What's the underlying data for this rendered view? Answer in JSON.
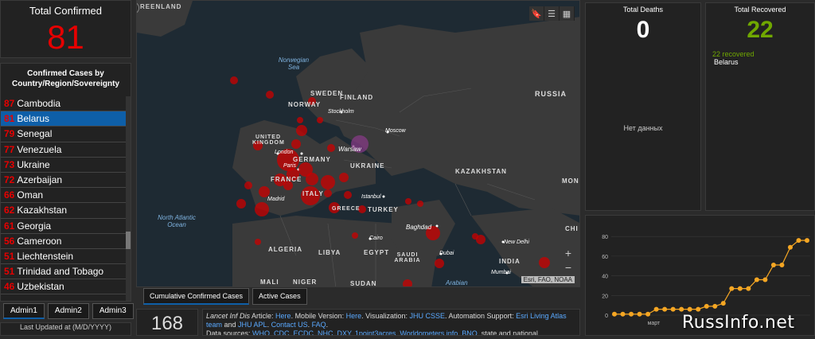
{
  "total_confirmed": {
    "label": "Total Confirmed",
    "value": "81"
  },
  "country_list": {
    "header": "Confirmed Cases by Country/Region/Sovereignty",
    "rows": [
      {
        "count": "87",
        "name": "Cambodia"
      },
      {
        "count": "81",
        "name": "Belarus"
      },
      {
        "count": "79",
        "name": "Senegal"
      },
      {
        "count": "77",
        "name": "Venezuela"
      },
      {
        "count": "73",
        "name": "Ukraine"
      },
      {
        "count": "72",
        "name": "Azerbaijan"
      },
      {
        "count": "66",
        "name": "Oman"
      },
      {
        "count": "62",
        "name": "Kazakhstan"
      },
      {
        "count": "61",
        "name": "Georgia"
      },
      {
        "count": "56",
        "name": "Cameroon"
      },
      {
        "count": "51",
        "name": "Liechtenstein"
      },
      {
        "count": "51",
        "name": "Trinidad and Tobago"
      },
      {
        "count": "46",
        "name": "Uzbekistan"
      }
    ]
  },
  "admin_tabs": [
    "Admin1",
    "Admin2",
    "Admin3"
  ],
  "last_updated": "Last Updated at (M/D/YYYY)",
  "map": {
    "labels": {
      "greenland": "REENLAND",
      "norwegian_sea": "Norwegian Sea",
      "sweden": "SWEDEN",
      "finland": "FINLAND",
      "norway": "NORWAY",
      "russia": "RUSSIA",
      "stockholm": "Stockholm",
      "moscow": "Moscow",
      "uk": "UNITED KINGDOM",
      "london": "London",
      "warsaw": "Warsaw",
      "germany": "GERMANY",
      "ukraine": "UKRAINE",
      "kazakhstan": "KAZAKHSTAN",
      "paris": "Paris",
      "france": "FRANCE",
      "italy": "ITALY",
      "madrid": "Madrid",
      "istanbul": "Istanbul",
      "greece": "GREECE",
      "turkey": "TURKEY",
      "mongolia": "MONG",
      "north_atlantic": "North Atlantic Ocean",
      "baghdad": "Baghdad",
      "china": "CHI",
      "algeria": "ALGERIA",
      "libya": "LIBYA",
      "egypt": "EGYPT",
      "cairo": "Cairo",
      "saudi": "SAUDI ARABIA",
      "dubai": "Dubai",
      "new_delhi": "New Delhi",
      "india": "INDIA",
      "mali": "MALI",
      "niger": "NIGER",
      "sudan": "SUDAN",
      "arabian": "Arabian",
      "mumbai": "Mumbai"
    },
    "attribution": "Esri, FAO, NOAA",
    "tabs": [
      "Cumulative Confirmed Cases",
      "Active Cases"
    ]
  },
  "bottom": {
    "count": "168",
    "info": {
      "t1": "Lancet Inf Dis",
      "t2": " Article: ",
      "here1": "Here",
      "t3": ". Mobile Version: ",
      "here2": "Here",
      "t4": ". Visualization: ",
      "jhu": "JHU CSSE",
      "t5": ". Automation Support: ",
      "esri": "Esri Living Atlas team",
      "t6": " and ",
      "apl": "JHU APL",
      "t7": ". ",
      "contact": "Contact US",
      "t8": ". ",
      "faq": "FAQ",
      "t9": ".",
      "t10": "Data sources: ",
      "sources": "WHO, CDC, ECDC, NHC, DXY, 1point3acres, Worldometers.info, BNO",
      "t11": ", state and national"
    }
  },
  "total_deaths": {
    "label": "Total Deaths",
    "value": "0",
    "no_data": "Нет данных"
  },
  "total_recovered": {
    "label": "Total Recovered",
    "value": "22",
    "recovered_count": "22",
    "recovered_word": "recovered",
    "country": "Belarus"
  },
  "chart_data": {
    "type": "line",
    "yticks": [
      0,
      20,
      40,
      60,
      80
    ],
    "ylim": [
      0,
      85
    ],
    "xlabel_tick": "март",
    "values": [
      1,
      1,
      1,
      1,
      1,
      6,
      6,
      6,
      6,
      6,
      6,
      9,
      9,
      12,
      27,
      27,
      27,
      36,
      36,
      51,
      51,
      69,
      76,
      76
    ],
    "color": "#f5a623"
  },
  "watermark": "RussInfo.net",
  "colors": {
    "accent": "#0e5fa8",
    "confirmed": "#e60000",
    "recovered": "#70a800"
  }
}
